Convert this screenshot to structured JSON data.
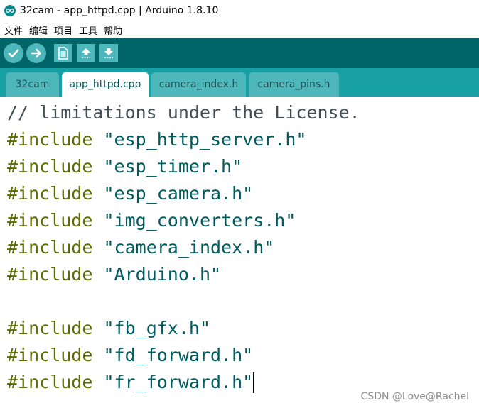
{
  "window": {
    "title": "32cam - app_httpd.cpp | Arduino 1.8.10"
  },
  "menu": [
    "文件",
    "编辑",
    "项目",
    "工具",
    "帮助"
  ],
  "toolbar": {
    "buttons": [
      "verify-icon",
      "upload-icon",
      "new-icon",
      "open-icon",
      "save-icon"
    ]
  },
  "tabs": [
    {
      "label": "32cam",
      "active": false
    },
    {
      "label": "app_httpd.cpp",
      "active": true
    },
    {
      "label": "camera_index.h",
      "active": false
    },
    {
      "label": "camera_pins.h",
      "active": false
    }
  ],
  "editor": {
    "lines": [
      {
        "kind": "comment",
        "text": "// limitations under the License."
      },
      {
        "kind": "include",
        "directive": "#include",
        "file": "\"esp_http_server.h\""
      },
      {
        "kind": "include",
        "directive": "#include",
        "file": "\"esp_timer.h\""
      },
      {
        "kind": "include",
        "directive": "#include",
        "file": "\"esp_camera.h\""
      },
      {
        "kind": "include",
        "directive": "#include",
        "file": "\"img_converters.h\""
      },
      {
        "kind": "include",
        "directive": "#include",
        "file": "\"camera_index.h\""
      },
      {
        "kind": "include",
        "directive": "#include",
        "file": "\"Arduino.h\""
      },
      {
        "kind": "blank"
      },
      {
        "kind": "include",
        "directive": "#include",
        "file": "\"fb_gfx.h\""
      },
      {
        "kind": "include",
        "directive": "#include",
        "file": "\"fd_forward.h\""
      },
      {
        "kind": "include",
        "directive": "#include",
        "file": "\"fr_forward.h\""
      }
    ]
  },
  "watermark": "CSDN @Love@Rachel",
  "colors": {
    "toolbar": "#006468",
    "tabbar": "#17a1a5",
    "tab": "#4db7bb",
    "preprocessor": "#5e6d03",
    "string": "#005c5f",
    "comment": "#434f54"
  }
}
